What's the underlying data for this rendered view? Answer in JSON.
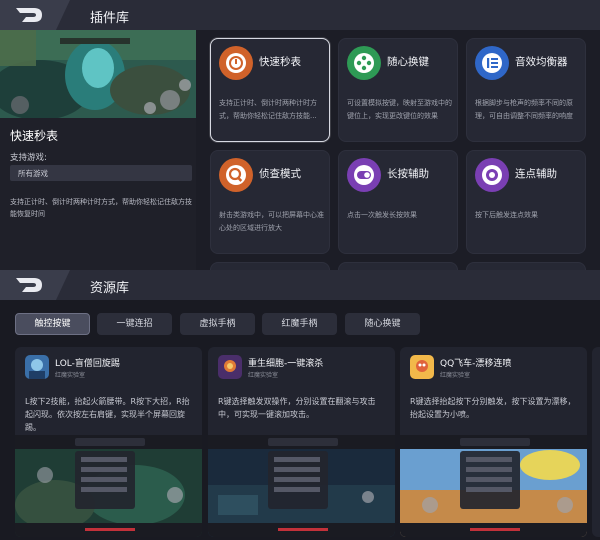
{
  "plugin_header": {
    "title": "插件库"
  },
  "selected": {
    "title": "快速秒表",
    "support_label": "支持游戏:",
    "support_tag": "所有游戏",
    "description": "支持正计时、倒计时两种计时方式，帮助你轻松记住敌方技能恢复时间"
  },
  "plugins": [
    {
      "name": "快速秒表",
      "desc": "支持正计时、倒计时两种计时方式，帮助你轻松记住敌方技能...",
      "color": "#d0622a",
      "icon": "stopwatch-icon"
    },
    {
      "name": "随心换键",
      "desc": "可设置模拟按键，映射至游戏中的键位上，实现更改键位的效果",
      "color": "#2e9a55",
      "icon": "gamepad-icon"
    },
    {
      "name": "音效均衡器",
      "desc": "根据脚步与枪声的频率不同的原理，可自由调整不同频率的响度",
      "color": "#2f67c8",
      "icon": "equalizer-icon"
    },
    {
      "name": "侦查模式",
      "desc": "射击类游戏中，可以把屏幕中心准心处的区域进行放大",
      "color": "#d0622a",
      "icon": "magnifier-icon"
    },
    {
      "name": "长按辅助",
      "desc": "点击一次触发长按效果",
      "color": "#7a3fb3",
      "icon": "toggle-icon"
    },
    {
      "name": "连点辅助",
      "desc": "按下后触发连点效果",
      "color": "#7a3fb3",
      "icon": "record-icon"
    }
  ],
  "resource_header": {
    "title": "资源库"
  },
  "tabs": [
    "触控按键",
    "一键连招",
    "虚拟手柄",
    "红魔手柄",
    "随心换键"
  ],
  "resources": [
    {
      "name": "LOL-盲僧回旋踢",
      "author": "红魔实验室",
      "desc": "L按下2技能，抬起火箭腰带。R按下大招，R抬起闪现。依次按左右肩键，实现半个屏幕回旋踢。"
    },
    {
      "name": "重生细胞-一键滚杀",
      "author": "红魔实验室",
      "desc": "R键选择触发双操作，分别设置在翻滚与攻击中，可实现一键滚加攻击。"
    },
    {
      "name": "QQ飞车-漂移连喷",
      "author": "红魔实验室",
      "desc": "R键选择抬起按下分别触发，按下设置为漂移，抬起设置为小喷。"
    }
  ],
  "colors": {
    "accent": "#d0622a",
    "green": "#2e9a55",
    "blue": "#2f67c8",
    "purple": "#7a3fb3"
  }
}
